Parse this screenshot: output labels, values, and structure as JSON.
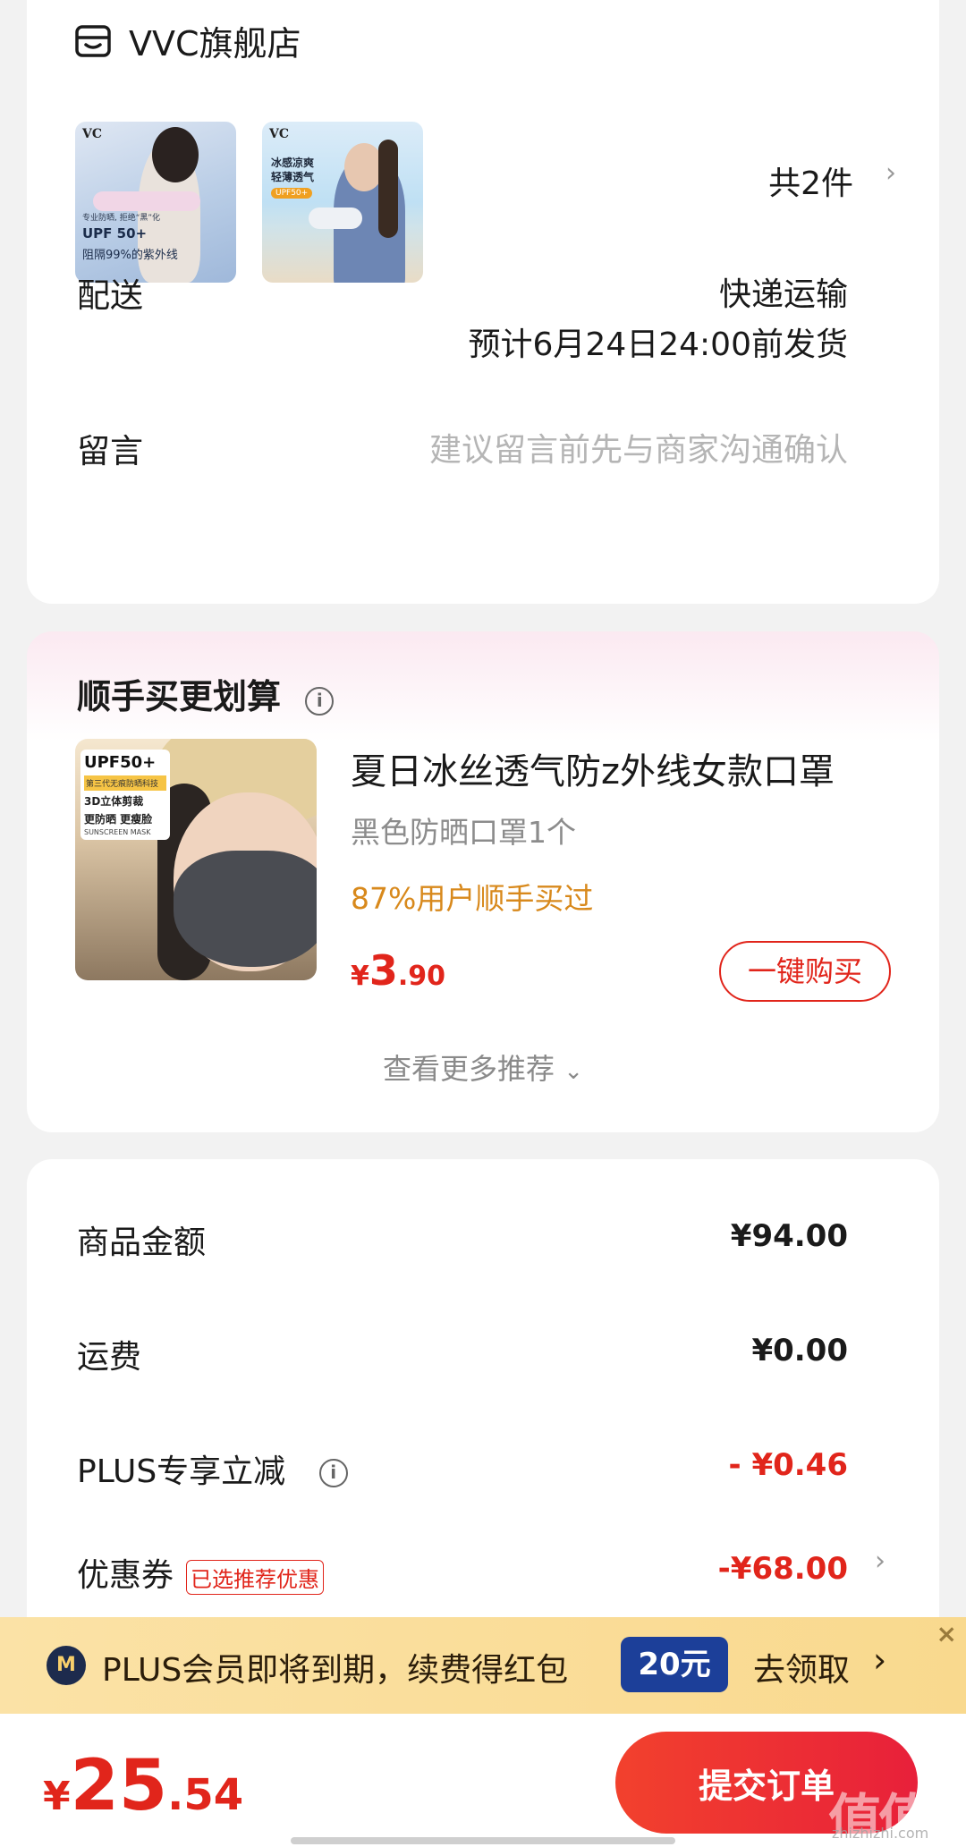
{
  "store": {
    "name": "VVC旗舰店",
    "count_label": "共2件",
    "products": [
      {
        "brand": "VC",
        "small": "专业防晒, 拒绝“黑”化",
        "upf": "UPF 50+",
        "block": "阻隔99%的紫外线"
      },
      {
        "brand": "VC",
        "cool_line1": "冰感凉爽",
        "cool_line2": "轻薄透气",
        "badge": "UPF50+"
      }
    ],
    "shipping": {
      "label": "配送",
      "method": "快递运输",
      "eta": "预计6月24日24:00前发货"
    },
    "message": {
      "label": "留言",
      "placeholder": "建议留言前先与商家沟通确认"
    }
  },
  "recommend": {
    "title": "顺手买更划算",
    "product": {
      "name": "夏日冰丝透气防z外线女款口罩",
      "spec": "黑色防晒口罩1个",
      "stat": "87%用户顺手买过",
      "price_symbol": "¥",
      "price_int": "3",
      "price_dec": ".90",
      "buy_label": "一键购买",
      "img_upf": "UPF50+",
      "img_tag": "第三代无痕防晒科技",
      "img_line1": "3D立体剪裁",
      "img_line2": "更防晒 更瘦脸",
      "img_en": "SUNSCREEN MASK"
    },
    "more_label": "查看更多推荐"
  },
  "price": {
    "rows": [
      {
        "label": "商品金额",
        "value": "¥94.00"
      },
      {
        "label": "运费",
        "value": "¥0.00"
      },
      {
        "label": "PLUS专享立减",
        "value": "- ¥0.46"
      },
      {
        "label": "优惠券",
        "tag": "已选推荐优惠",
        "value": "-¥68.00"
      }
    ]
  },
  "plus_banner": {
    "logo": "M",
    "text": "PLUS会员即将到期，续费得红包",
    "amount": "20元",
    "claim": "去领取"
  },
  "bottom": {
    "symbol": "¥",
    "total_int": "25",
    "total_dec": ".54",
    "submit_label": "提交订单",
    "watermark": "值值值",
    "watermark_sub": "zhizhizhi.com"
  },
  "colors": {
    "accent_red": "#e1251b",
    "stat_orange": "#d8891c",
    "plus_blue": "#1c3f99",
    "banner_gold": "#f9d98e"
  }
}
